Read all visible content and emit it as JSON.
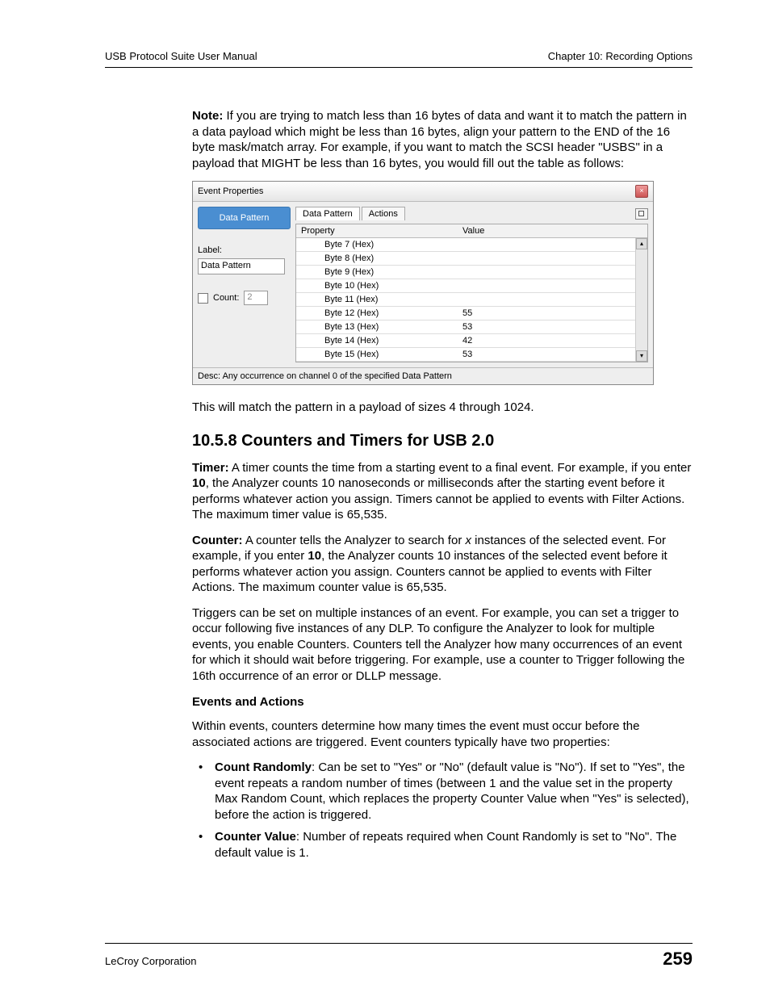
{
  "header": {
    "left": "USB Protocol Suite User Manual",
    "right": "Chapter 10: Recording Options"
  },
  "note": {
    "label": "Note:",
    "text": " If you are trying to match less than 16 bytes of data and want it to match the pattern in a data payload which might be less than 16 bytes, align your pattern to the END of the 16 byte mask/match array. For example, if you want to match the SCSI header \"USBS\" in a payload that MIGHT be less than 16 bytes, you would fill out the table as follows:"
  },
  "shot": {
    "title": "Event Properties",
    "close_glyph": "×",
    "data_pattern_btn": "Data Pattern",
    "label_text": "Label:",
    "label_value": "Data Pattern",
    "count_label": "Count:",
    "count_value": "2",
    "tabs": {
      "active": "Data Pattern",
      "other": "Actions"
    },
    "headers": {
      "prop": "Property",
      "val": "Value"
    },
    "rows": [
      {
        "prop": "Byte 7 (Hex)",
        "val": ""
      },
      {
        "prop": "Byte 8 (Hex)",
        "val": ""
      },
      {
        "prop": "Byte 9 (Hex)",
        "val": ""
      },
      {
        "prop": "Byte 10 (Hex)",
        "val": ""
      },
      {
        "prop": "Byte 11 (Hex)",
        "val": ""
      },
      {
        "prop": "Byte 12 (Hex)",
        "val": "55"
      },
      {
        "prop": "Byte 13 (Hex)",
        "val": "53"
      },
      {
        "prop": "Byte 14 (Hex)",
        "val": "42"
      },
      {
        "prop": "Byte 15 (Hex)",
        "val": "53"
      }
    ],
    "scroll": {
      "up": "▴",
      "down": "▾"
    },
    "desc": "Desc: Any occurrence on channel 0 of the specified Data Pattern"
  },
  "after_shot": "This will match the pattern in a payload of sizes 4 through 1024.",
  "section": {
    "heading": "10.5.8 Counters and Timers for USB 2.0",
    "timer_label": "Timer:",
    "timer_text_1": " A timer counts the time from a starting event to a final event. For example, if you enter ",
    "timer_bold": "10",
    "timer_text_2": ", the Analyzer counts 10 nanoseconds or milliseconds after the starting event before it performs whatever action you assign. Timers cannot be applied to events with Filter Actions. The maximum timer value is 65,535.",
    "counter_label": "Counter:",
    "counter_text_1": " A counter tells the Analyzer to search for ",
    "counter_italic": "x",
    "counter_text_2": " instances of the selected event. For example, if you enter ",
    "counter_bold": "10",
    "counter_text_3": ", the Analyzer counts 10 instances of the selected event before it performs whatever action you assign. Counters cannot be applied to events with Filter Actions. The maximum counter value is 65,535.",
    "triggers_para": "Triggers can be set on multiple instances of an event. For example, you can set a trigger to occur following five instances of any DLP. To configure the Analyzer to look for multiple events, you enable Counters. Counters tell the Analyzer how many occurrences of an event for which it should wait before triggering. For example, use a counter to Trigger following the 16th occurrence of an error or DLLP message.",
    "ea_heading": "Events and Actions",
    "ea_para": "Within events, counters determine how many times the event must occur before the associated actions are triggered. Event counters typically have two properties:",
    "bullets": {
      "b1_label": "Count Randomly",
      "b1_text": ": Can be set to \"Yes\" or \"No\" (default value is \"No\"). If set to \"Yes\", the event repeats a random number of times (between 1 and the value set in the property Max Random Count, which replaces the property Counter Value when \"Yes\" is selected), before the action is triggered.",
      "b2_label": "Counter Value",
      "b2_text": ": Number of repeats required when Count Randomly is set to \"No\". The default value is 1."
    }
  },
  "footer": {
    "left": "LeCroy Corporation",
    "page": "259"
  }
}
